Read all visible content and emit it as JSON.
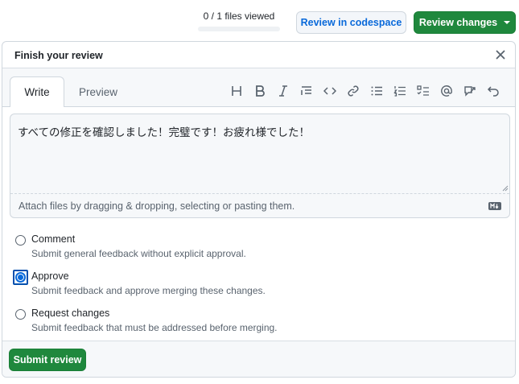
{
  "header": {
    "files_viewed": "0 / 1 files viewed",
    "codespace_button": "Review in codespace",
    "review_changes_button": "Review changes"
  },
  "panel": {
    "title": "Finish your review",
    "tabs": [
      "Write",
      "Preview"
    ],
    "toolbar_icons": [
      "heading-icon",
      "bold-icon",
      "italic-icon",
      "quote-icon",
      "code-icon",
      "link-icon",
      "unordered-list-icon",
      "ordered-list-icon",
      "task-list-icon",
      "mention-icon",
      "reference-icon",
      "undo-icon"
    ],
    "comment_text": "すべての修正を確認しました！完璧です！お疲れ様でした！",
    "attach_hint": "Attach files by dragging & dropping, selecting or pasting them.",
    "options": [
      {
        "label": "Comment",
        "description": "Submit general feedback without explicit approval.",
        "selected": false
      },
      {
        "label": "Approve",
        "description": "Submit feedback and approve merging these changes.",
        "selected": true
      },
      {
        "label": "Request changes",
        "description": "Submit feedback that must be addressed before merging.",
        "selected": false
      }
    ],
    "submit_button": "Submit review"
  },
  "colors": {
    "primary_green": "#1f883d",
    "link_blue": "#0969da",
    "border": "#d0d7de",
    "muted_text": "#59636e"
  }
}
